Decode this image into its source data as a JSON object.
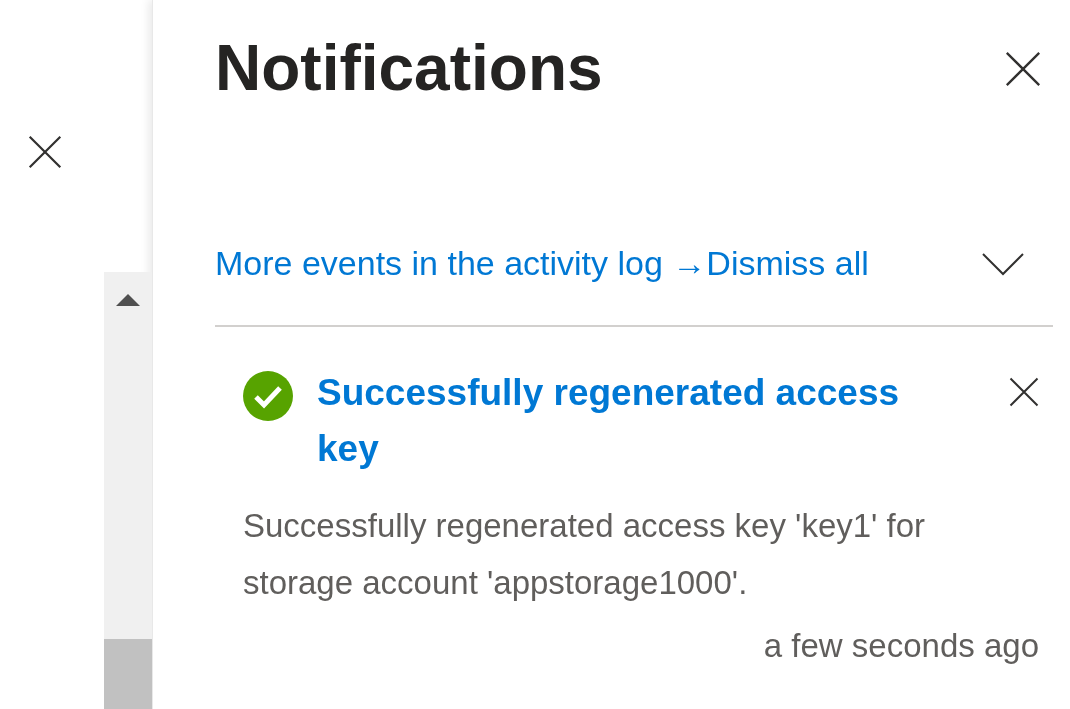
{
  "panel": {
    "title": "Notifications"
  },
  "links": [
    {
      "label": "More events in the activity log →"
    },
    {
      "label": "Dismiss all"
    }
  ],
  "notifications": [
    {
      "kind": "success",
      "title": "Successfully regenerated access key",
      "message": "Successfully regenerated access key 'key1' for storage account 'appstorage1000'.",
      "time": "a few seconds ago"
    }
  ]
}
